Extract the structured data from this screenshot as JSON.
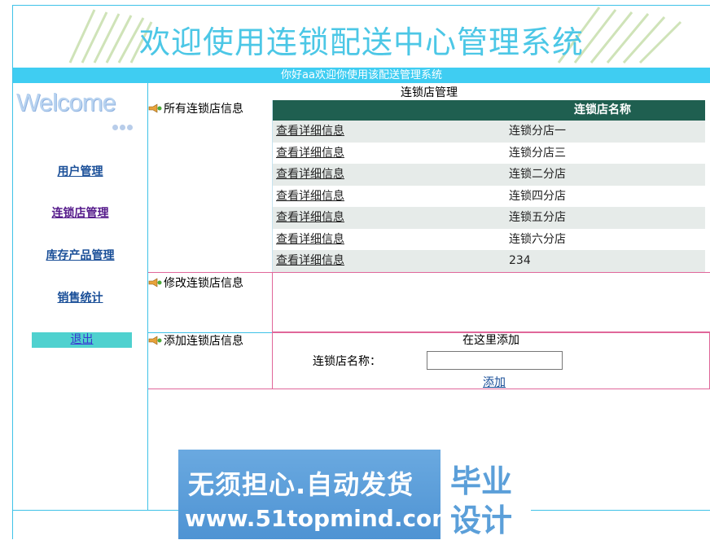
{
  "banner": {
    "title": "欢迎使用连锁配送中心管理系统"
  },
  "greeting": "你好aa欢迎你使用该配送管理系统",
  "sidebar": {
    "logo_text": "Welcome",
    "items": [
      {
        "label": "用户管理"
      },
      {
        "label": "连锁店管理"
      },
      {
        "label": "库存产品管理"
      },
      {
        "label": "销售统计"
      }
    ],
    "logout_label": "退出"
  },
  "content": {
    "title": "连锁店管理",
    "sections": {
      "all_stores": "所有连锁店信息",
      "edit_store": "修改连锁店信息",
      "add_store": "添加连锁店信息"
    },
    "table": {
      "header": "连锁店名称",
      "rows": [
        {
          "link": "查看详细信息",
          "name": "连锁分店一"
        },
        {
          "link": "查看详细信息",
          "name": "连锁分店三"
        },
        {
          "link": "查看详细信息",
          "name": "连锁二分店"
        },
        {
          "link": "查看详细信息",
          "name": "连锁四分店"
        },
        {
          "link": "查看详细信息",
          "name": "连锁五分店"
        },
        {
          "link": "查看详细信息",
          "name": "连锁六分店"
        },
        {
          "link": "查看详细信息",
          "name": "234"
        }
      ]
    },
    "add_form": {
      "title": "在这里添加",
      "field_label": "连锁店名称：",
      "field_value": "",
      "submit_label": "添加"
    }
  },
  "ad": {
    "line1": "无须担心.自动发货",
    "line2": "www.51topmind.com",
    "right1": "毕业",
    "right2": "设计"
  }
}
